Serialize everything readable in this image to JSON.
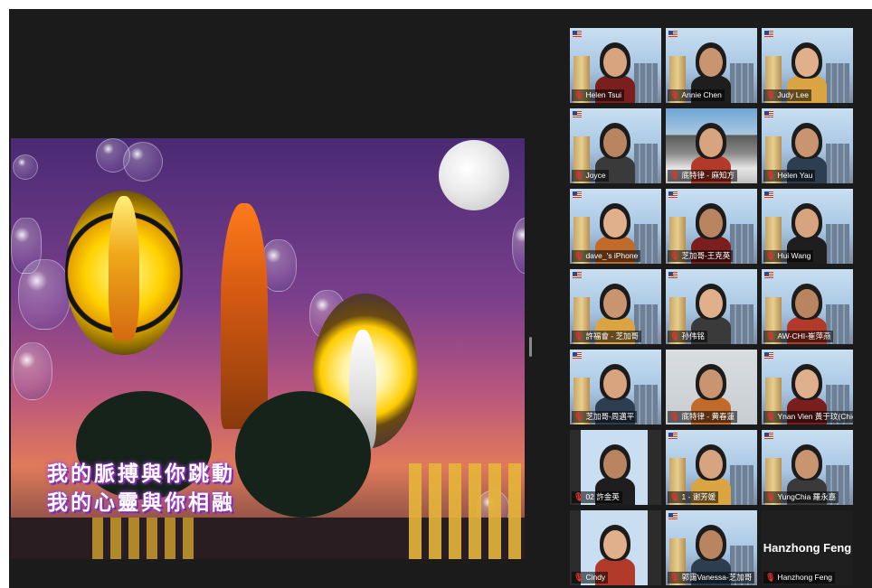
{
  "shared_screen": {
    "caption_line1": "我的脈搏與你跳動",
    "caption_line2": "我的心靈與你相融"
  },
  "participants": [
    {
      "name": "Helen Tsui",
      "bg": "city"
    },
    {
      "name": "Annie Chen",
      "bg": "city"
    },
    {
      "name": "Judy Lee",
      "bg": "city"
    },
    {
      "name": "Joyce",
      "bg": "city"
    },
    {
      "name": "底特律 - 麻知方",
      "bg": "mountain"
    },
    {
      "name": "Helen Yau",
      "bg": "city"
    },
    {
      "name": "dave_'s iPhone",
      "bg": "city"
    },
    {
      "name": "芝加哥-王克英",
      "bg": "city"
    },
    {
      "name": "Hui Wang",
      "bg": "city"
    },
    {
      "name": "許福會 - 芝加哥",
      "bg": "city"
    },
    {
      "name": "孙伟铭",
      "bg": "city"
    },
    {
      "name": "AW-CHI-崔萍燕",
      "bg": "city"
    },
    {
      "name": "芝加哥-周邁平",
      "bg": "city"
    },
    {
      "name": "底特律 - 黄春蓮",
      "bg": "room"
    },
    {
      "name": "Ynan Vien 黃于玟(Chic...",
      "bg": "city"
    },
    {
      "name": "02  許金英",
      "bg": "half"
    },
    {
      "name": "1 - 谢芳媛",
      "bg": "city"
    },
    {
      "name": "YungChia 羅永嘉",
      "bg": "city"
    },
    {
      "name": "Cindy",
      "bg": "half"
    },
    {
      "name": "郭靄Vanessa-芝加哥",
      "bg": "city"
    },
    {
      "name": "Hanzhong Feng",
      "bg": "black"
    }
  ],
  "camera_off_display": "Hanzhong Feng",
  "active_speaker": "YungChia 羅永嘉",
  "colors": {
    "window_bg": "#1b1b1b",
    "active_border": "#b7e23f",
    "muted_mic": "#e5332a"
  },
  "icons": {
    "muted_mic": "mic-off-icon",
    "flag": "us-flag-icon"
  }
}
